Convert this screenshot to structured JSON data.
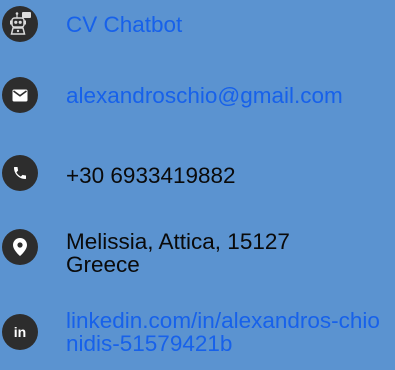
{
  "colors": {
    "background": "#5b93d0",
    "icon_circle": "#2d2d2d",
    "link_text": "#1761ea",
    "plain_text": "#0a0a0a"
  },
  "contacts": [
    {
      "icon": "robot-icon",
      "text": "CV Chatbot",
      "type": "link"
    },
    {
      "icon": "mail-icon",
      "text": "alexandroschio@gmail.com",
      "type": "link"
    },
    {
      "icon": "phone-icon",
      "text": "+30 6933419882",
      "type": "text"
    },
    {
      "icon": "location-pin-icon",
      "text": "Melissia, Attica, 15127 Greece",
      "type": "text"
    },
    {
      "icon": "linkedin-icon",
      "text": "linkedin.com/in/alexandros-chionidis-51579421b",
      "type": "link"
    }
  ]
}
